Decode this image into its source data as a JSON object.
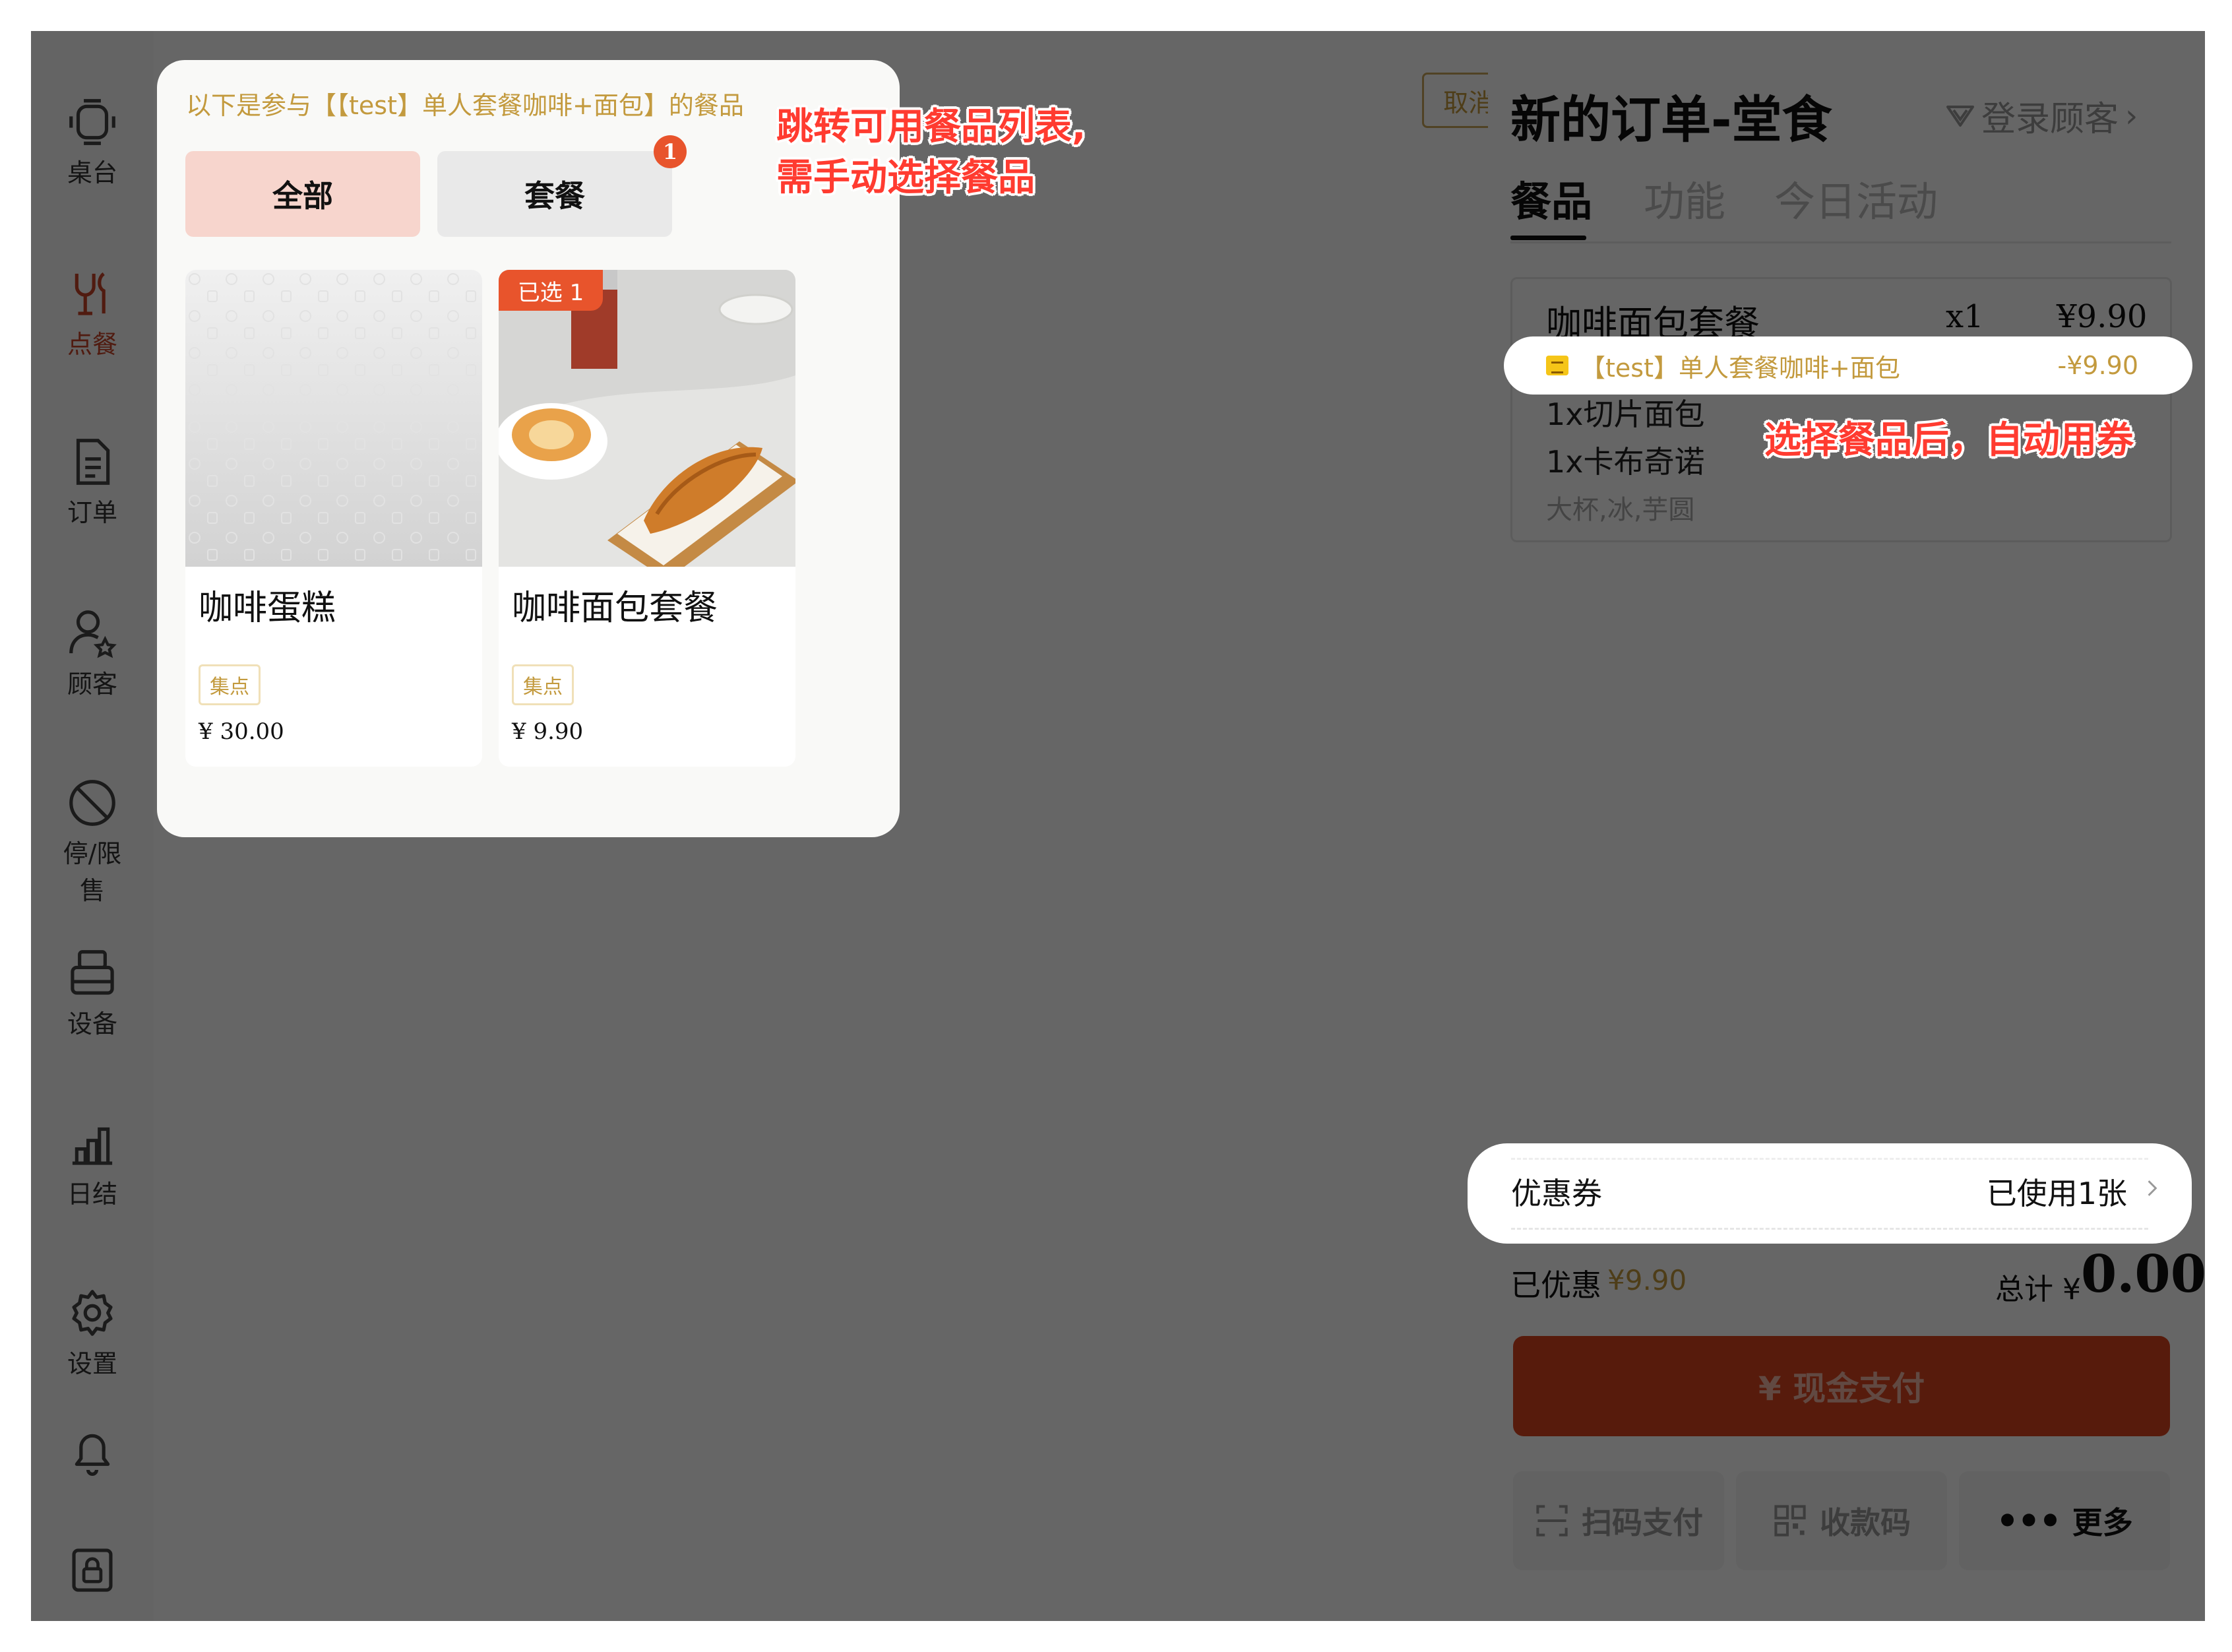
{
  "sidebar": {
    "items": [
      {
        "label": "桌台",
        "icon": "table-icon"
      },
      {
        "label": "点餐",
        "icon": "cutlery-icon",
        "active": true
      },
      {
        "label": "订单",
        "icon": "document-icon"
      },
      {
        "label": "顾客",
        "icon": "customer-star-icon"
      },
      {
        "label": "停/限售",
        "icon": "ban-icon"
      },
      {
        "label": "设备",
        "icon": "printer-icon"
      },
      {
        "label": "日结",
        "icon": "bar-chart-icon"
      },
      {
        "label": "设置",
        "icon": "gear-icon"
      },
      {
        "label": "",
        "icon": "bell-icon"
      },
      {
        "label": "",
        "icon": "lock-icon"
      }
    ]
  },
  "filter": {
    "cancel_label": "取消筛选",
    "cancel_icon": "close-icon"
  },
  "popup": {
    "hint": "以下是参与【【test】单人套餐咖啡+面包】的餐品",
    "tabs": [
      {
        "label": "全部",
        "active": true
      },
      {
        "label": "套餐",
        "badge": "1"
      }
    ],
    "products": [
      {
        "name": "咖啡蛋糕",
        "tag": "集点",
        "price": "¥ 30.00",
        "selected": ""
      },
      {
        "name": "咖啡面包套餐",
        "tag": "集点",
        "price": "¥ 9.90",
        "selected": "已选 1"
      }
    ]
  },
  "order": {
    "title": "新的订单-堂食",
    "login_customer": "登录顾客",
    "tabs": [
      {
        "label": "餐品",
        "active": true
      },
      {
        "label": "功能"
      },
      {
        "label": "今日活动"
      }
    ],
    "item": {
      "name": "咖啡面包套餐",
      "qty": "x1",
      "price": "¥9.90",
      "coupon_name": "【test】单人套餐咖啡+面包",
      "coupon_amount": "-¥9.90",
      "sub1": "1x切片面包",
      "sub2": "1x卡布奇诺",
      "options": "大杯,冰,芋圆"
    },
    "coupon_row": {
      "label": "优惠券",
      "value": "已使用1张"
    },
    "discount_label": "已优惠",
    "discount_value": "¥9.90",
    "total_label": "总计 ¥",
    "total_value": "0.00",
    "cash_pay": "¥ 现金支付",
    "scan_pay": "扫码支付",
    "qr_code": "收款码",
    "more": "更多"
  },
  "annotations": {
    "jump_line1": "跳转可用餐品列表,",
    "jump_line2": "需手动选择餐品",
    "auto_coupon": "选择餐品后，自动用券"
  },
  "colors": {
    "accent": "#d9441f",
    "gold": "#c39a3e",
    "overlay": "rgba(0,0,0,0.6)"
  }
}
